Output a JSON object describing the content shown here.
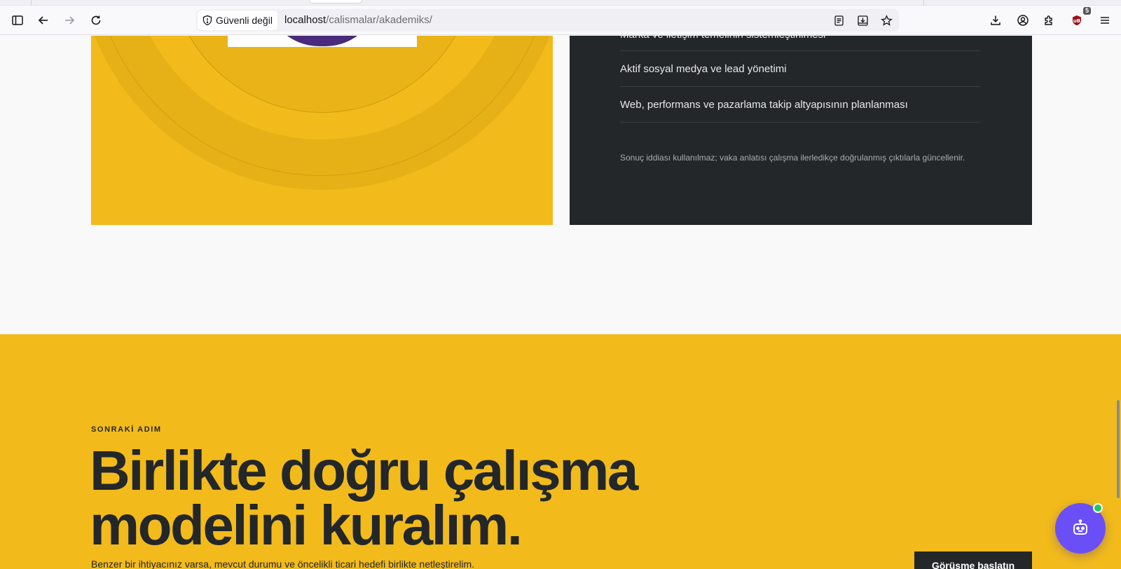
{
  "browser": {
    "security_label": "Güvenli değil",
    "url_host": "localhost",
    "url_path": "/calismalar/akademiks/",
    "extension_badge": "5",
    "icons": [
      "sidebar-icon",
      "back-icon",
      "forward-icon",
      "reload-icon",
      "shield-icon",
      "reader-view-icon",
      "save-page-icon",
      "bookmark-star-icon",
      "downloads-icon",
      "account-icon",
      "extensions-icon",
      "addon-icon",
      "menu-icon"
    ]
  },
  "scope_panel": {
    "items": [
      "Marka ve iletişim temelinin sistemleştirilmesi",
      "Aktif sosyal medya ve lead yönetimi",
      "Web, performans ve pazarlama takip altyapısının planlanması"
    ],
    "note": "Sonuç iddiası kullanılmaz; vaka anlatısı çalışma ilerledikçe doğrulanmış çıktılarla güncellenir."
  },
  "cta": {
    "eyebrow": "SONRAKİ ADIM",
    "headline": "Birlikte doğru çalışma modelini kuralım.",
    "subtext": "Benzer bir ihtiyacınız varsa, mevcut durumu ve öncelikli ticari hedefi birlikte netleştirelim.",
    "button_label": "Görüşme başlatın"
  },
  "chatbot": {
    "icon": "bot-icon",
    "status": "online"
  },
  "colors": {
    "accent_yellow": "#f2bb1b",
    "dark": "#23272a",
    "bot_purple": "#6b4ff6",
    "status_green": "#22c55e"
  }
}
